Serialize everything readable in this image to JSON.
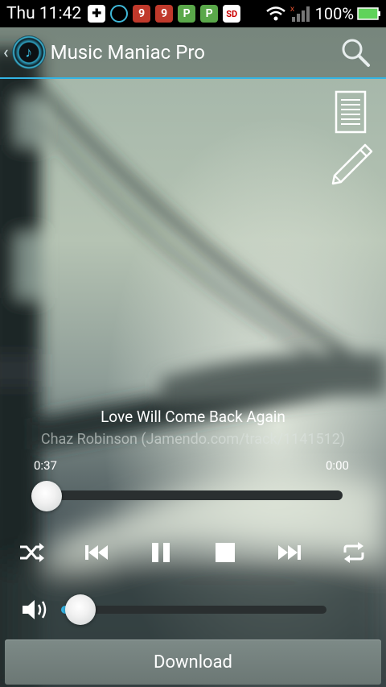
{
  "status_bar": {
    "time": "Thu 11:42",
    "battery_percent": "100%",
    "icons": [
      "medical-cross-icon",
      "circle-app-icon",
      "red-9-icon",
      "red-9-icon",
      "green-p-icon",
      "green-p-icon",
      "sd-card-icon",
      "wifi-icon",
      "signal-icon",
      "battery-icon"
    ]
  },
  "action_bar": {
    "back_glyph": "‹",
    "title": "Music Maniac Pro"
  },
  "track": {
    "title": "Love Will Come Back Again",
    "artist": "Chaz Robinson (Jamendo.com/track/1141512)",
    "current_time": "0:37",
    "total_time": "0:00",
    "progress": 0.0
  },
  "volume": {
    "level": 0.05
  },
  "download_label": "Download",
  "colors": {
    "accent": "#33b5e5",
    "status_bg": "#000000"
  }
}
